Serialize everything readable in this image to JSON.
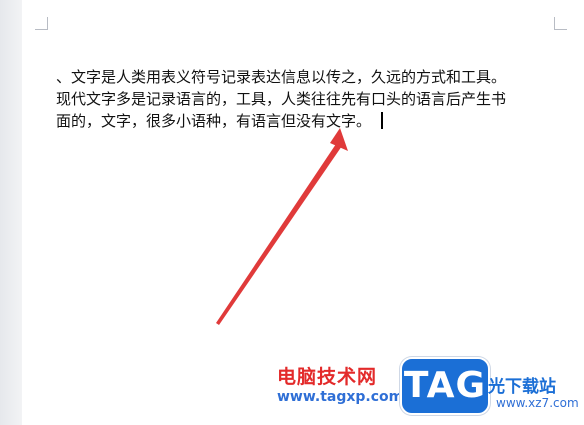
{
  "document": {
    "lines": [
      "、文字是人类用表义符号记录表达信息以传之，久远的方式和工具。",
      "现代文字多是记录语言的，工具，人类往往先有口头的语言后产生书",
      "面的，文字，很多小语种，有语言但没有文字。"
    ]
  },
  "annotation": {
    "color": "#e03a3a"
  },
  "watermark": {
    "brand_cn": "电脑技术网",
    "brand_url": "www.tagxp.com",
    "logo_text": "TAG",
    "site_cn": "光下载站",
    "site_url": "www.xz7.com",
    "logo_color": "#1b6fd6",
    "brand_color": "#e32a2a"
  }
}
